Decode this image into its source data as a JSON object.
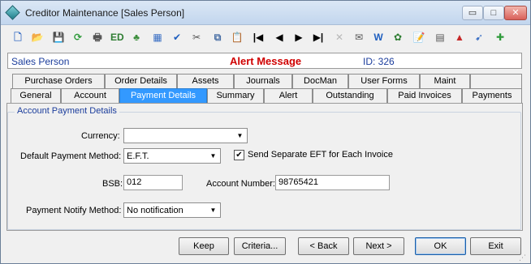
{
  "window": {
    "title": "Creditor Maintenance  [Sales Person]"
  },
  "window_controls": {
    "min": "▭",
    "max": "□",
    "close": "✕"
  },
  "toolbar": {
    "icons": [
      "new-document-icon",
      "open-folder-icon",
      "save-icon",
      "refresh-icon",
      "print-icon",
      "edit-icon",
      "tree-icon",
      "calculator-icon",
      "spellcheck-icon",
      "cut-icon",
      "copy-icon",
      "paste-icon",
      "first-record-icon",
      "previous-record-icon",
      "next-record-icon",
      "last-record-icon",
      "delete-icon",
      "email-icon",
      "word-icon",
      "lookup-icon",
      "notes-icon",
      "calendar-icon",
      "user-icon",
      "tag-icon",
      "add-icon"
    ],
    "glyphs": [
      "🗋",
      "📂",
      "💾",
      "⟳",
      "🖶",
      "ED",
      "♣",
      "▦",
      "✔",
      "✂",
      "⧉",
      "📋",
      "|◀",
      "◀",
      "▶",
      "▶|",
      "✕",
      "✉",
      "W",
      "✿",
      "📝",
      "▤",
      "▲",
      "➹",
      "✚"
    ],
    "colors": [
      "#3a6fc4",
      "#d6a42c",
      "#9a9a9a",
      "#2e9a3a",
      "#555",
      "#2e7d32",
      "#3b8d3b",
      "#3a6fc4",
      "#1f5fbf",
      "#555",
      "#4a6fa5",
      "#c58a1c",
      "#000",
      "#000",
      "#000",
      "#000",
      "#b8b8b8",
      "#555",
      "#1f5fbf",
      "#2e7d32",
      "#c58a1c",
      "#555",
      "#c62828",
      "#3a6fc4",
      "#2e9a3a"
    ]
  },
  "info": {
    "person": "Sales Person",
    "alert": "Alert Message",
    "id": "ID: 326"
  },
  "tabs_row1": [
    "Purchase Orders",
    "Order Details",
    "Assets",
    "Journals",
    "DocMan",
    "User Forms",
    "Maint"
  ],
  "tabs_row2": [
    "General",
    "Account",
    "Payment Details",
    "Summary",
    "Alert",
    "Outstanding",
    "Paid Invoices",
    "Payments"
  ],
  "group": {
    "title": "Account Payment Details"
  },
  "form": {
    "currency_label": "Currency:",
    "currency_value": "",
    "method_label": "Default Payment Method:",
    "method_value": "E.F.T.",
    "separate_eft_label": "Send Separate EFT for Each Invoice",
    "separate_eft_checked": "✔",
    "bsb_label": "BSB:",
    "bsb_value": "012",
    "account_number_label": "Account Number:",
    "account_number_value": "98765421",
    "notify_label": "Payment Notify Method:",
    "notify_value": "No notification",
    "dropdown_arrow": "▼"
  },
  "buttons": {
    "keep": "Keep",
    "criteria": "Criteria...",
    "back": "< Back",
    "next": "Next >",
    "ok": "OK",
    "exit": "Exit"
  },
  "grip": "⋰"
}
